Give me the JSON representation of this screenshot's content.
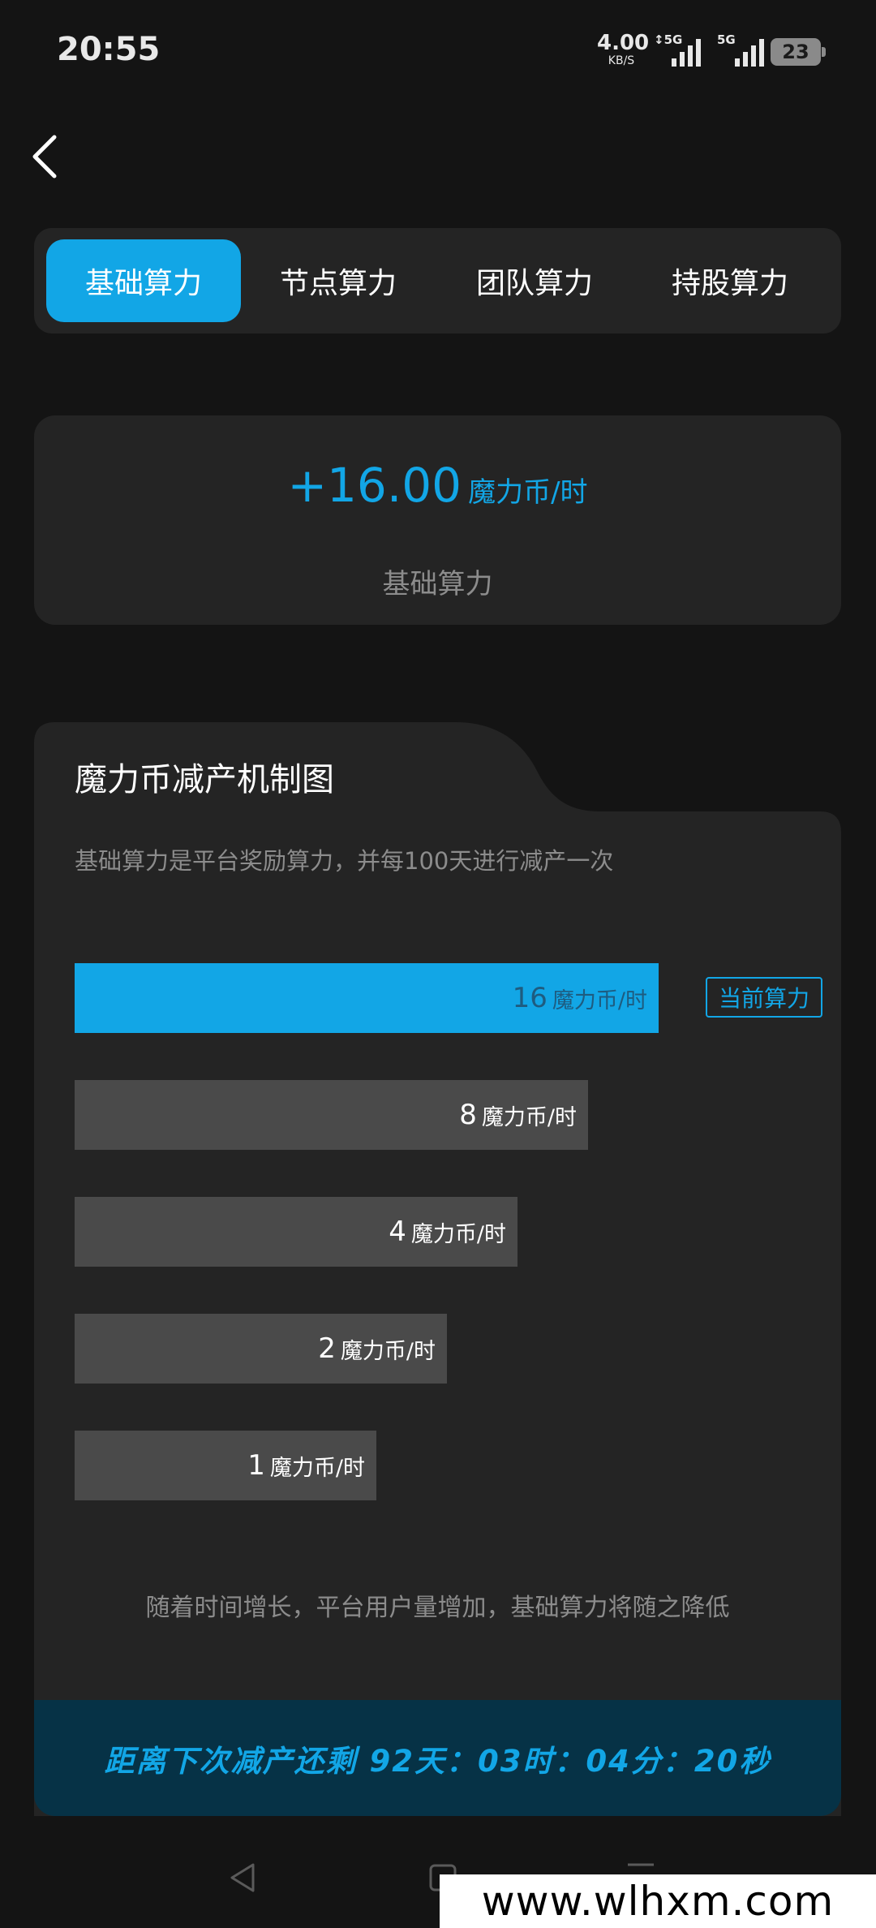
{
  "status": {
    "time": "20:55",
    "speed_value": "4.00",
    "speed_unit": "KB/S",
    "sim1_label": "↕5G",
    "sim2_label": "5G",
    "battery": "23"
  },
  "tabs": [
    {
      "label": "基础算力",
      "active": true
    },
    {
      "label": "节点算力",
      "active": false
    },
    {
      "label": "团队算力",
      "active": false
    },
    {
      "label": "持股算力",
      "active": false
    }
  ],
  "hero": {
    "value": "+16.00",
    "unit": "魔力币/时",
    "label": "基础算力"
  },
  "mechanism": {
    "title": "魔力币减产机制图",
    "description": "基础算力是平台奖励算力，并每100天进行减产一次",
    "unit": "魔力币/时",
    "current_badge": "当前算力",
    "levels": [
      {
        "value": "16",
        "amount": 16,
        "current": true
      },
      {
        "value": "8",
        "amount": 8,
        "current": false
      },
      {
        "value": "4",
        "amount": 4,
        "current": false
      },
      {
        "value": "2",
        "amount": 2,
        "current": false
      },
      {
        "value": "1",
        "amount": 1,
        "current": false
      }
    ],
    "footer_note": "随着时间增长，平台用户量增加，基础算力将随之降低",
    "countdown": "距离下次减产还剩  92天：03时：04分：20秒"
  },
  "watermark": "www.wlhxm.com",
  "colors": {
    "accent": "#12a6e6",
    "background": "#141414",
    "card": "#242424",
    "bar_inactive": "#4a4a4a",
    "countdown_bg": "#063246"
  }
}
